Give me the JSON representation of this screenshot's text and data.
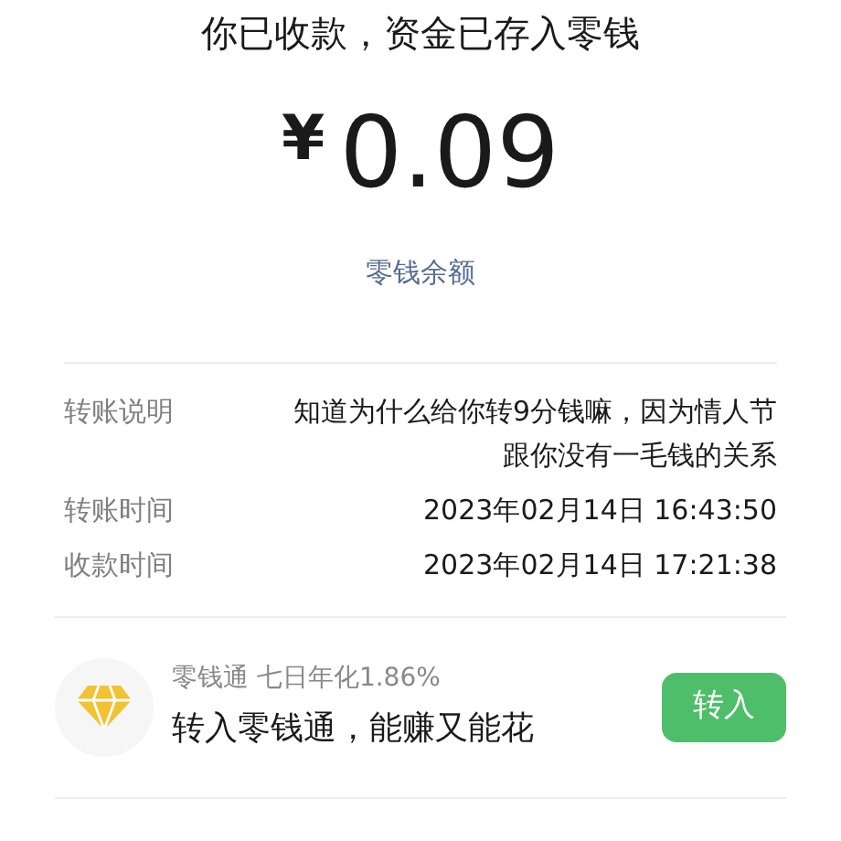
{
  "title": "你已收款，资金已存入零钱",
  "amount": {
    "currency": "¥",
    "value": "0.09"
  },
  "balance_link": "零钱余额",
  "details": [
    {
      "label": "转账说明",
      "value": "知道为什么给你转9分钱嘛，因为情人节跟你没有一毛钱的关系"
    },
    {
      "label": "转账时间",
      "value": "2023年02月14日 16:43:50"
    },
    {
      "label": "收款时间",
      "value": "2023年02月14日 17:21:38"
    }
  ],
  "promo": {
    "subtitle": "零钱通 七日年化1.86%",
    "headline": "转入零钱通，能赚又能花",
    "button": "转入"
  }
}
